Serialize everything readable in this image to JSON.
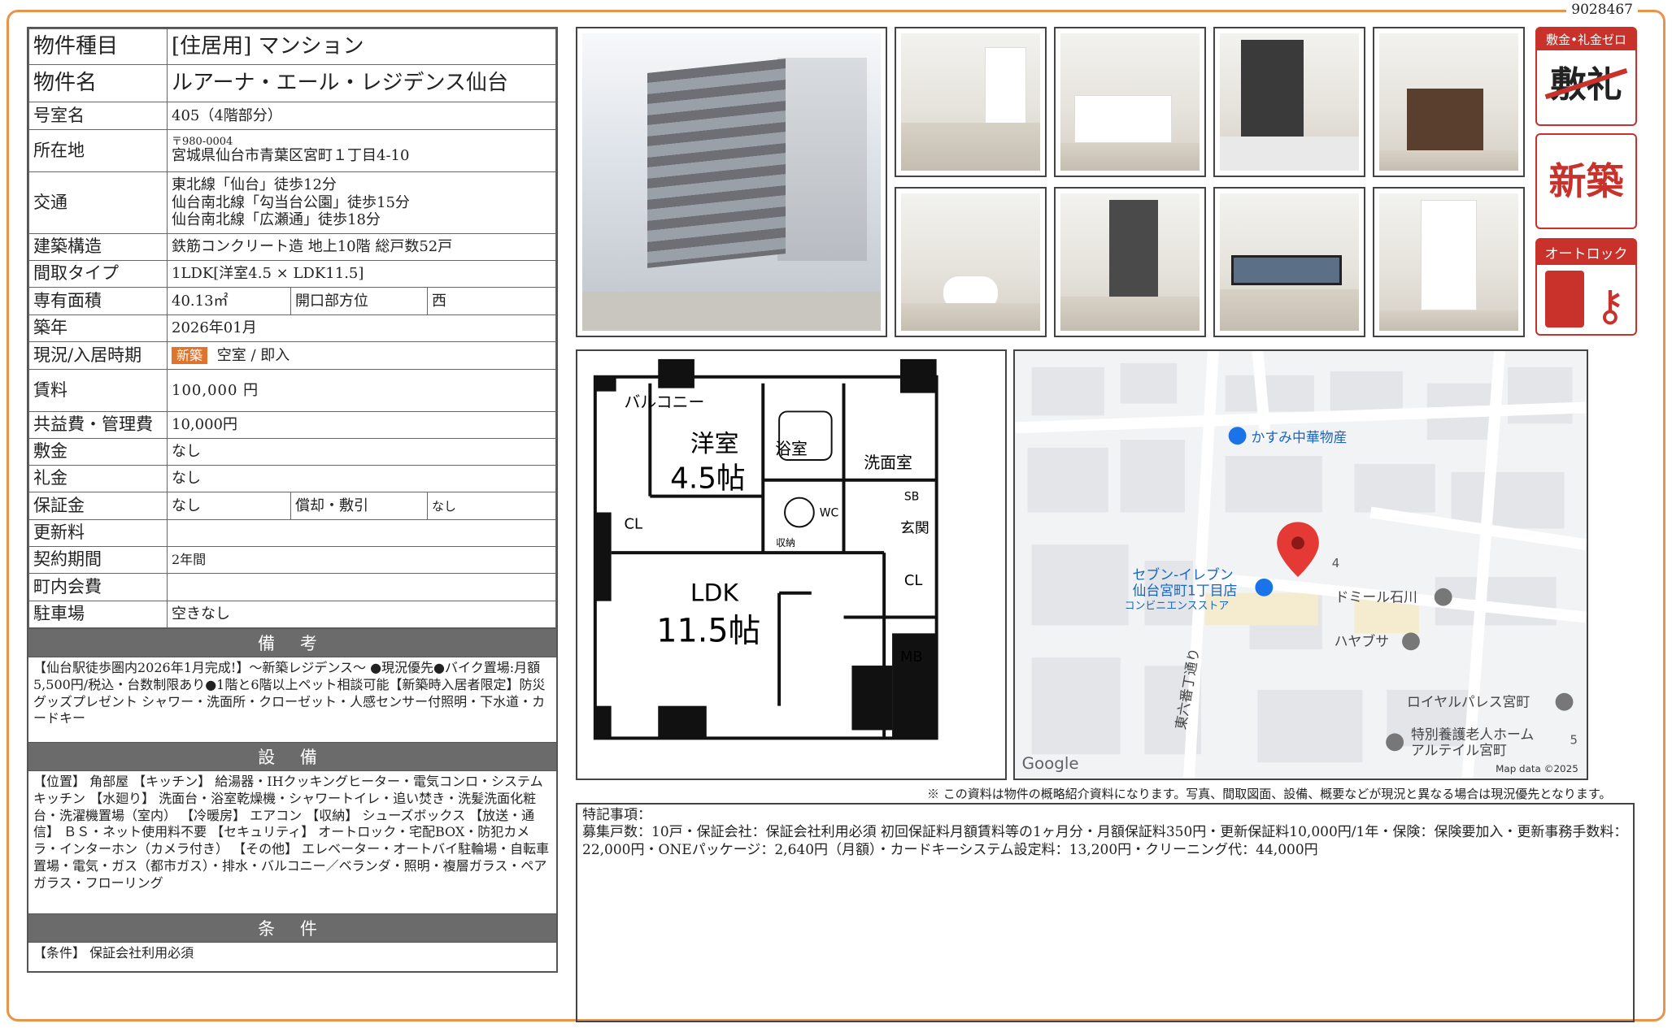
{
  "doc_id": "9028467",
  "info": {
    "type_label": "物件種目",
    "type_value": "[住居用] マンション",
    "name_label": "物件名",
    "name_value": "ルアーナ・エール・レジデンス仙台",
    "room_label": "号室名",
    "room_value": "405（4階部分）",
    "address_label": "所在地",
    "postal": "〒980-0004",
    "address_value": "宮城県仙台市青葉区宮町１丁目4-10",
    "transport_label": "交通",
    "transport": [
      "東北線「仙台」徒歩12分",
      "仙台南北線「勾当台公園」徒歩15分",
      "仙台南北線「広瀬通」徒歩18分"
    ],
    "structure_label": "建築構造",
    "structure_value": "鉄筋コンクリート造 地上10階 総戸数52戸",
    "layout_label": "間取タイプ",
    "layout_value": "1LDK[洋室4.5 × LDK11.5]",
    "area_label": "専有面積",
    "area_value": "40.13㎡",
    "direction_label": "開口部方位",
    "direction_value": "西",
    "built_label": "築年",
    "built_value": "2026年01月",
    "status_label": "現況/入居時期",
    "status_badge": "新築",
    "status_value": "空室 / 即入",
    "rent_label": "賃料",
    "rent_value": "100,000 円",
    "fee_label": "共益費・管理費",
    "fee_value": "10,000円",
    "deposit_label": "敷金",
    "deposit_value": "なし",
    "key_money_label": "礼金",
    "key_money_value": "なし",
    "guarantee_label": "保証金",
    "guarantee_value": "なし",
    "amort_label": "償却・敷引",
    "amort_value": "なし",
    "renewal_label": "更新料",
    "renewal_value": "",
    "contract_label": "契約期間",
    "contract_value": "2年間",
    "town_fee_label": "町内会費",
    "town_fee_value": "",
    "parking_label": "駐車場",
    "parking_value": "空きなし"
  },
  "remarks": {
    "heading": "備 考",
    "text": "【仙台駅徒歩圏内2026年1月完成!】～新築レジデンス～ ●現況優先●バイク置場:月額5,500円/税込・台数制限あり●1階と6階以上ペット相談可能【新築時入居者限定】防災グッズプレゼント シャワー・洗面所・クローゼット・人感センサー付照明・下水道・カードキー"
  },
  "equipment": {
    "heading": "設 備",
    "text": "【位置】 角部屋 【キッチン】 給湯器・IHクッキングヒーター・電気コンロ・システムキッチン 【水廻り】 洗面台・浴室乾燥機・シャワートイレ・追い焚き・洗髪洗面化粧台・洗濯機置場（室内） 【冷暖房】 エアコン 【収納】 シューズボックス 【放送・通信】 ＢＳ・ネット使用料不要 【セキュリティ】 オートロック・宅配BOX・防犯カメラ・インターホン（カメラ付き） 【その他】 エレベーター・オートバイ駐輪場・自転車置場・電気・ガス（都市ガス）・排水・バルコニー／ベランダ・照明・複層ガラス・ペアガラス・フローリング"
  },
  "conditions": {
    "heading": "条 件",
    "text": "【条件】 保証会社利用必須"
  },
  "icons": {
    "zero_title": "敷金•礼金ゼロ",
    "zero_glyph": "敷礼",
    "new_label": "新築",
    "autolock_title": "オートロック"
  },
  "floorplan": {
    "balcony": "バルコニー",
    "western_room": "洋室",
    "western_size": "4.5帖",
    "bath": "浴室",
    "washroom": "洗面室",
    "wc": "WC",
    "sb": "SB",
    "entrance": "玄関",
    "storage": "収納",
    "cl1": "CL",
    "cl2": "CL",
    "ldk": "LDK",
    "ldk_size": "11.5帖",
    "mb": "MB"
  },
  "map": {
    "poi_1": "かすみ中華物産",
    "poi_2a": "セブン-イレブン",
    "poi_2b": "仙台宮町1丁目店",
    "poi_2c": "コンビニエンスストア",
    "poi_3": "ドミール石川",
    "poi_4": "ハヤブサ",
    "poi_5": "ロイヤルパレス宮町",
    "poi_6a": "特別養護老人ホーム",
    "poi_6b": "アルテイル宮町",
    "road": "東六番丁通り",
    "num_4": "4",
    "num_5": "5",
    "google": "Google",
    "mapdata": "Map data ©2025"
  },
  "disclaimer": "※ この資料は物件の概略紹介資料になります。写真、間取図面、設備、概要などが現況と異なる場合は現況優先となります。",
  "notes": {
    "heading": "特記事項：",
    "text": "募集戸数：10戸・保証会社：保証会社利用必須 初回保証料月額賃料等の1ヶ月分・月額保証料350円・更新保証料10,000円/1年・保険：保険要加入・更新事務手数料：22,000円・ONEパッケージ：2,640円（月額）・カードキーシステム設定料：13,200円・クリーニング代：44,000円"
  },
  "colors": {
    "frame": "#e8944a",
    "accent_red": "#c9322a",
    "badge": "#e0742c",
    "section_head": "#6b6b6b"
  }
}
